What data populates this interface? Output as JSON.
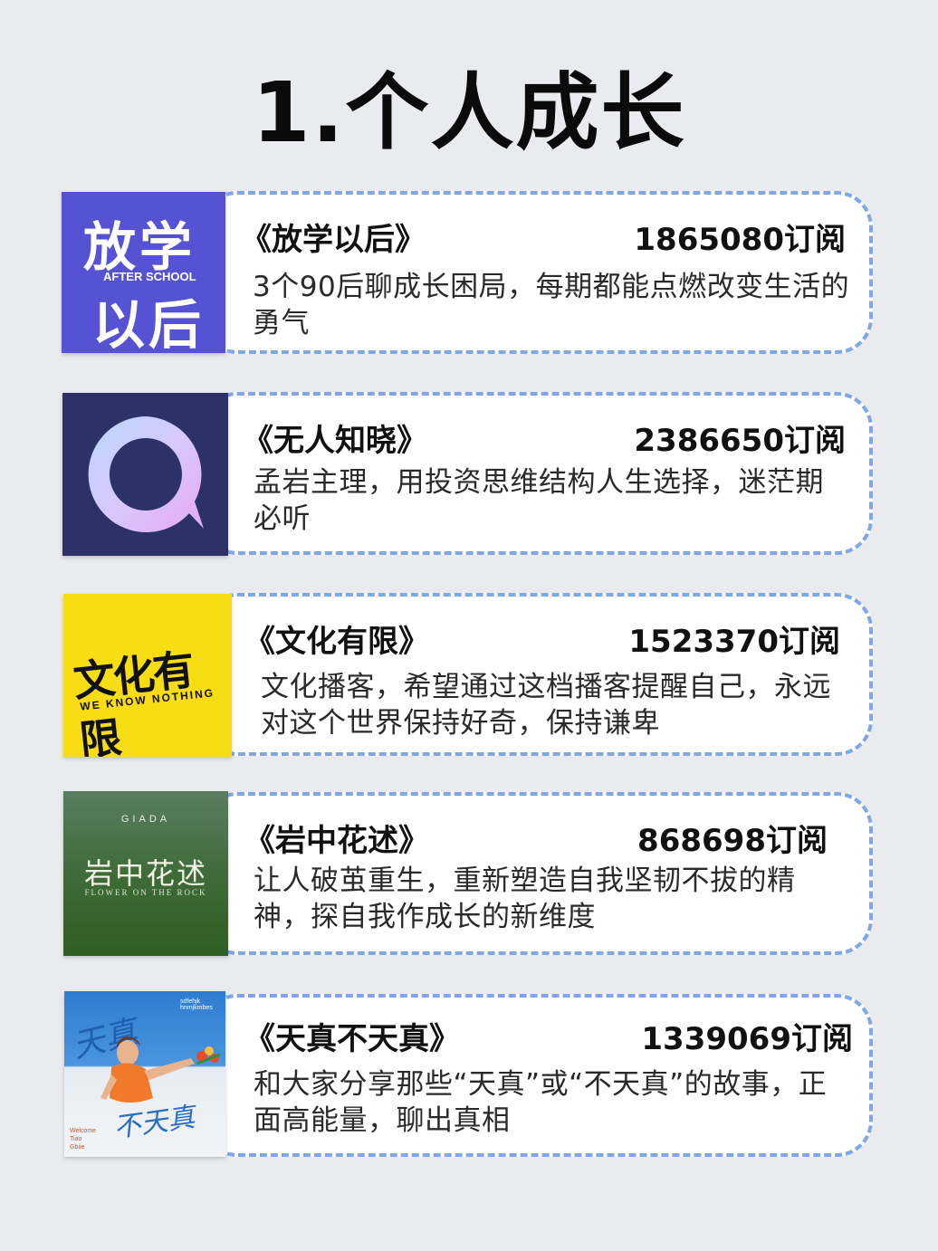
{
  "page": {
    "title": "1.个人成长"
  },
  "podcasts": [
    {
      "name": "《放学以后》",
      "subscribers": "1865080订阅",
      "description": "3个90后聊成长困局，每期都能点燃改变生活的勇气",
      "cover": {
        "line1": "放学",
        "subtitle": "AFTER SCHOOL",
        "line2": "以后",
        "color": "#5552d4"
      }
    },
    {
      "name": "《无人知晓》",
      "subscribers": "2386650订阅",
      "description": "孟岩主理，用投资思维结构人生选择，迷茫期必听",
      "cover": {
        "icon": "speech-bubble-ring-icon",
        "color": "#2c3168"
      }
    },
    {
      "name": "《文化有限》",
      "subscribers": "1523370订阅",
      "description": "文化播客，希望通过这档播客提醒自己，永远对这个世界保持好奇，保持谦卑",
      "cover": {
        "title": "文化有限",
        "subtitle": "WE KNOW NOTHING",
        "color": "#f8dc14"
      }
    },
    {
      "name": "《岩中花述》",
      "subscribers": "868698订阅",
      "description": "让人破茧重生，重新塑造自我坚韧不拔的精神，探自我作成长的新维度",
      "cover": {
        "brand": "GIADA",
        "title": "岩中花述",
        "subtitle": "FLOWER ON THE ROCK",
        "color": "#3d6a36"
      }
    },
    {
      "name": "《天真不天真》",
      "subscribers": "1339069订阅",
      "description": "和大家分享那些“天真”或“不天真”的故事，正面高能量，聊出真相",
      "cover": {
        "script_top": "天真",
        "script_bottom": "不天真",
        "corner_text": "sdfehjk hnmjkmbes",
        "side_text": "Welcome Tiao Gbiie",
        "color": "#2e7cd2"
      }
    }
  ]
}
